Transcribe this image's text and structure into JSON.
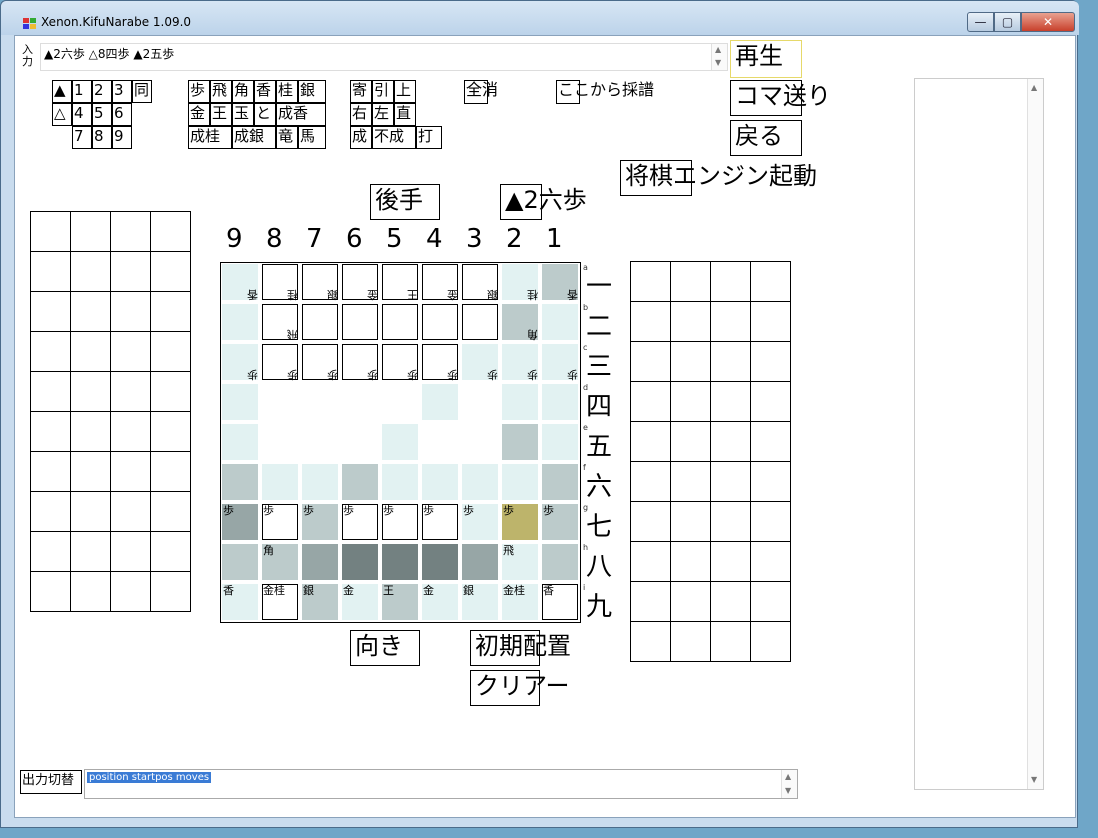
{
  "window": {
    "title": "Xenon.KifuNarabe 1.09.0",
    "min": "—",
    "max": "▢",
    "close": "✕"
  },
  "input": {
    "label": "入\n力",
    "value": "▲2六歩 △8四歩 ▲2五歩"
  },
  "play_buttons": {
    "play": "再生",
    "step": "コマ送り",
    "back": "戻る",
    "engine": "将棋エンジン起動"
  },
  "num_keys": [
    "▲",
    "1",
    "2",
    "3",
    "同",
    "△",
    "4",
    "5",
    "6",
    "",
    "",
    "7",
    "8",
    "9",
    ""
  ],
  "piece_keys": [
    "歩",
    "飛",
    "角",
    "香",
    "桂",
    "銀",
    "金",
    "王",
    "玉",
    "と",
    "成香",
    "",
    "成桂",
    "成銀",
    "竜",
    "馬"
  ],
  "modifier_keys": [
    "寄",
    "引",
    "上",
    "右",
    "左",
    "直",
    "成",
    "不成",
    "打"
  ],
  "clear_all": "全消",
  "record_from_here": "ここから採譜",
  "side_label": "後手",
  "last_move": "▲2六歩",
  "files": [
    "9",
    "8",
    "7",
    "6",
    "5",
    "4",
    "3",
    "2",
    "1"
  ],
  "ranks": [
    "一",
    "二",
    "三",
    "四",
    "五",
    "六",
    "七",
    "八",
    "九"
  ],
  "rank_letters": [
    "a",
    "b",
    "c",
    "d",
    "e",
    "f",
    "g",
    "h",
    "i"
  ],
  "board_rows": [
    [
      "香",
      "桂",
      "銀",
      "金",
      "王",
      "金",
      "銀",
      "桂",
      "香"
    ],
    [
      "",
      "飛",
      "",
      "",
      "",
      "",
      "",
      "角",
      ""
    ],
    [
      "歩",
      "歩",
      "歩",
      "歩",
      "歩",
      "歩",
      "歩",
      "歩",
      "歩"
    ],
    [
      "",
      "",
      "",
      "",
      "",
      "",
      "",
      "",
      ""
    ],
    [
      "",
      "",
      "",
      "",
      "",
      "",
      "",
      "",
      ""
    ],
    [
      "",
      "",
      "",
      "",
      "",
      "",
      "",
      "",
      ""
    ],
    [
      "歩",
      "歩",
      "歩",
      "歩",
      "歩",
      "歩",
      "歩",
      "歩",
      "歩"
    ],
    [
      "",
      "角",
      "",
      "",
      "",
      "",
      "",
      "飛",
      ""
    ],
    [
      "香",
      "金桂",
      "銀",
      "金",
      "王",
      "金",
      "銀",
      "金桂",
      "香"
    ]
  ],
  "board_sub_gote": [
    "",
    "",
    "",
    "",
    "",
    "",
    "",
    "",
    ""
  ],
  "board_colors": [
    [
      "#e2f2f2",
      "#ffffff",
      "#ffffff",
      "#ffffff",
      "#ffffff",
      "#ffffff",
      "#ffffff",
      "#e2f2f2",
      "#bccbcb"
    ],
    [
      "#e2f2f2",
      "#ffffff",
      "#ffffff",
      "#ffffff",
      "#ffffff",
      "#ffffff",
      "#ffffff",
      "#bccbcb",
      "#e2f2f2"
    ],
    [
      "#e2f2f2",
      "#ffffff",
      "#ffffff",
      "#ffffff",
      "#ffffff",
      "#ffffff",
      "#e2f2f2",
      "#e2f2f2",
      "#e2f2f2"
    ],
    [
      "#e2f2f2",
      "#ffffff",
      "#ffffff",
      "#ffffff",
      "#ffffff",
      "#e2f2f2",
      "#ffffff",
      "#e2f2f2",
      "#e2f2f2"
    ],
    [
      "#e2f2f2",
      "#ffffff",
      "#ffffff",
      "#ffffff",
      "#e2f2f2",
      "#ffffff",
      "#ffffff",
      "#bccbcb",
      "#e2f2f2"
    ],
    [
      "#bccbcb",
      "#e2f2f2",
      "#e2f2f2",
      "#bccbcb",
      "#e2f2f2",
      "#e2f2f2",
      "#e2f2f2",
      "#e2f2f2",
      "#bccbcb"
    ],
    [
      "#97a6a6",
      "#ffffff",
      "#bccbcb",
      "#ffffff",
      "#ffffff",
      "#ffffff",
      "#e2f2f2",
      "#bdb46b",
      "#bccbcb"
    ],
    [
      "#bccbcb",
      "#bccbcb",
      "#97a6a6",
      "#738181",
      "#738181",
      "#738181",
      "#97a6a6",
      "#e2f2f2",
      "#bccbcb"
    ],
    [
      "#e2f2f2",
      "#ffffff",
      "#bccbcb",
      "#e2f2f2",
      "#bccbcb",
      "#e2f2f2",
      "#e2f2f2",
      "#e2f2f2",
      "#ffffff"
    ]
  ],
  "orientation_button": "向き",
  "initial_button": "初期配置",
  "clear_button": "クリアー",
  "output_toggle": "出力切替",
  "output_value": "position startpos moves"
}
